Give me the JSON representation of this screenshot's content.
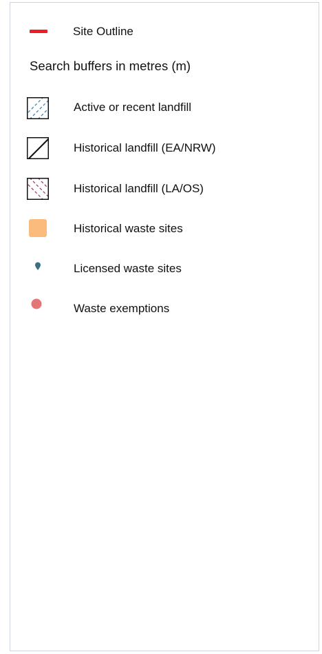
{
  "legend": {
    "site_outline_label": "Site Outline",
    "heading": "Search buffers in metres (m)",
    "items": [
      {
        "label": "Active or recent landfill",
        "icon": "diagonal-blue-dash-hatch-icon",
        "color": "#2a83b8"
      },
      {
        "label": "Historical landfill (EA/NRW)",
        "icon": "diagonal-black-line-icon",
        "color": "#111111"
      },
      {
        "label": "Historical landfill (LA/OS)",
        "icon": "diagonal-magenta-dash-hatch-icon",
        "color": "#b3266d"
      },
      {
        "label": "Historical waste sites",
        "icon": "orange-square-icon",
        "color": "#fbbb7c"
      },
      {
        "label": "Licensed waste sites",
        "icon": "teal-map-pin-icon",
        "color": "#3c7089"
      },
      {
        "label": "Waste exemptions",
        "icon": "red-circle-icon",
        "color": "#e37576"
      }
    ],
    "site_outline_color": "#ee1c25"
  }
}
